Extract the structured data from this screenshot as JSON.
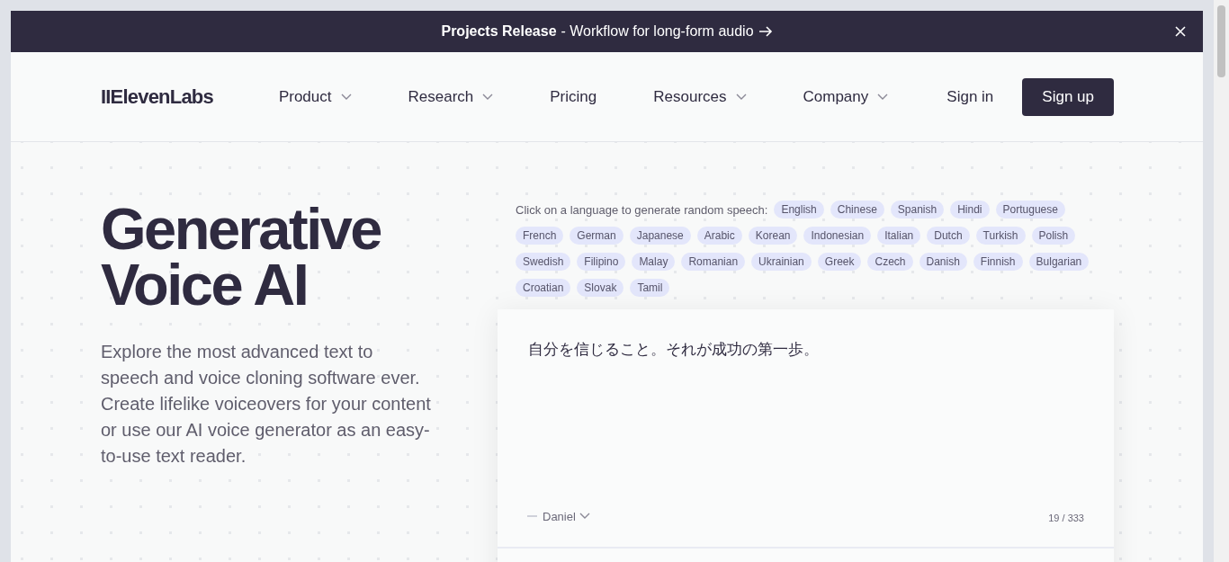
{
  "banner": {
    "title": "Projects Release",
    "text": "- Workflow for long-form audio"
  },
  "nav": {
    "logo": "IIElevenLabs",
    "items": [
      {
        "label": "Product",
        "dropdown": true
      },
      {
        "label": "Research",
        "dropdown": true
      },
      {
        "label": "Pricing",
        "dropdown": false
      },
      {
        "label": "Resources",
        "dropdown": true
      },
      {
        "label": "Company",
        "dropdown": true
      }
    ],
    "sign_in": "Sign in",
    "sign_up": "Sign up"
  },
  "hero": {
    "title_lines": [
      "Generative",
      "Voice AI"
    ],
    "description": "Explore the most advanced text to speech and voice cloning software ever. Create lifelike voiceovers for your content or use our AI voice generator as an easy-to-use text reader."
  },
  "languages": {
    "label": "Click on a language to generate random speech:",
    "items": [
      "English",
      "Chinese",
      "Spanish",
      "Hindi",
      "Portuguese",
      "French",
      "German",
      "Japanese",
      "Arabic",
      "Korean",
      "Indonesian",
      "Italian",
      "Dutch",
      "Turkish",
      "Polish",
      "Swedish",
      "Filipino",
      "Malay",
      "Romanian",
      "Ukrainian",
      "Greek",
      "Czech",
      "Danish",
      "Finnish",
      "Bulgarian",
      "Croatian",
      "Slovak",
      "Tamil"
    ]
  },
  "card": {
    "text": "自分を信じること。それが成功の第一歩。",
    "voice": "Daniel",
    "counter": "19 / 333"
  }
}
